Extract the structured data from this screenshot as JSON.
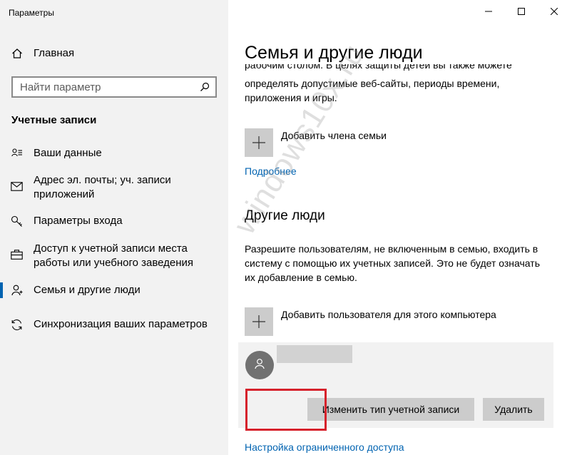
{
  "window": {
    "title": "Параметры"
  },
  "sidebar": {
    "home_label": "Главная",
    "search_placeholder": "Найти параметр",
    "section_label": "Учетные записи",
    "items": [
      {
        "label": "Ваши данные",
        "icon": "person-card-icon"
      },
      {
        "label": "Адрес эл. почты; уч. записи приложений",
        "icon": "mail-icon"
      },
      {
        "label": "Параметры входа",
        "icon": "key-icon"
      },
      {
        "label": "Доступ к учетной записи места работы или учебного заведения",
        "icon": "briefcase-icon"
      },
      {
        "label": "Семья и другие люди",
        "icon": "person-icon",
        "active": true
      },
      {
        "label": "Синхронизация ваших параметров",
        "icon": "sync-icon"
      }
    ]
  },
  "main": {
    "title": "Семья и другие люди",
    "family_paragraph_cut": "рабочим столом. В целях защиты детей вы также можете",
    "family_paragraph": "определять допустимые веб-сайты, периоды времени, приложения и игры.",
    "add_family_label": "Добавить члена семьи",
    "more_link": "Подробнее",
    "other_people_title": "Другие люди",
    "other_people_paragraph": "Разрешите пользователям, не включенным в семью, входить в систему с помощью их учетных записей. Это не будет означать их добавление в семью.",
    "add_user_label": "Добавить пользователя для этого компьютера",
    "user_card": {
      "change_type_label": "Изменить тип учетной записи",
      "delete_label": "Удалить"
    },
    "restricted_access_link": "Настройка ограниченного доступа"
  },
  "watermark": "windows10x.ru",
  "colors": {
    "accent": "#0063b1",
    "sidebar_bg": "#f2f2f2",
    "button_bg": "#cccccc",
    "highlight": "#d6222c"
  }
}
